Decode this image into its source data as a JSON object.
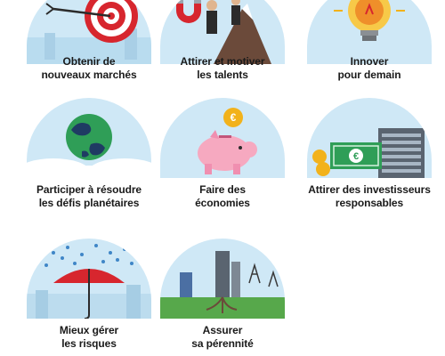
{
  "tiles": [
    {
      "line1": "Obtenir de",
      "line2": "nouveaux marchés"
    },
    {
      "line1": "Attirer et motiver",
      "line2": "les talents"
    },
    {
      "line1": "Innover",
      "line2": "pour demain"
    },
    {
      "line1": "Participer à résoudre",
      "line2": "les défis planétaires"
    },
    {
      "line1": "Faire des",
      "line2": "économies"
    },
    {
      "line1": "Attirer des investisseurs",
      "line2": "responsables"
    },
    {
      "line1": "Mieux gérer",
      "line2": "les risques"
    },
    {
      "line1": "Assurer",
      "line2": "sa pérennité"
    }
  ],
  "icons": [
    "target-dart-icon",
    "magnet-talents-icon",
    "lightbulb-icon",
    "earth-globe-icon",
    "piggy-bank-icon",
    "euro-money-buildings-icon",
    "umbrella-rain-icon",
    "city-tree-roots-icon"
  ],
  "colors": {
    "dome": "#cfe8f6",
    "text": "#1a1a1a",
    "accent_red": "#d7262e",
    "accent_green": "#2f9e57",
    "accent_gold": "#f2b21b"
  }
}
